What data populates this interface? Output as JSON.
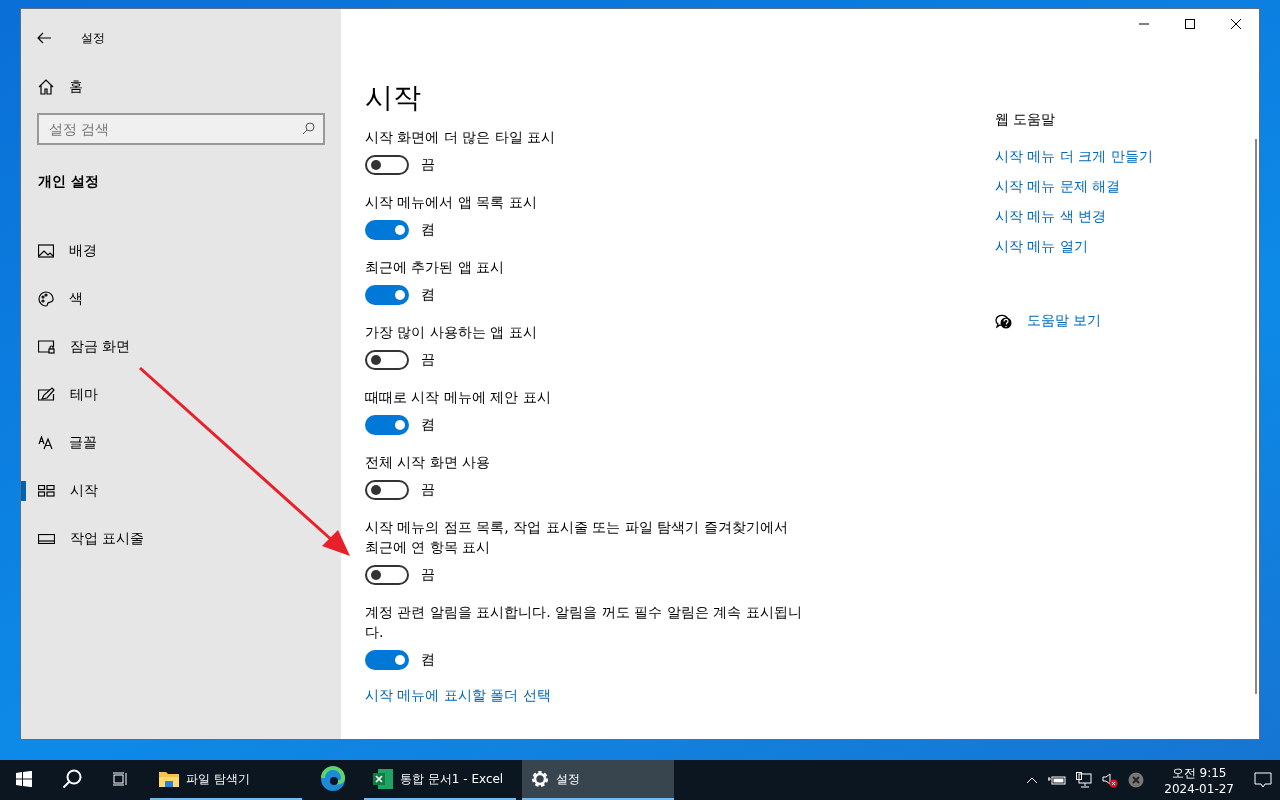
{
  "window": {
    "title": "설정"
  },
  "sidebar": {
    "home": "홈",
    "search": {
      "placeholder": "설정 검색"
    },
    "section": "개인 설정",
    "items": [
      {
        "label": "배경",
        "selected": false
      },
      {
        "label": "색",
        "selected": false
      },
      {
        "label": "잠금 화면",
        "selected": false
      },
      {
        "label": "테마",
        "selected": false
      },
      {
        "label": "글꼴",
        "selected": false
      },
      {
        "label": "시작",
        "selected": true
      },
      {
        "label": "작업 표시줄",
        "selected": false
      }
    ]
  },
  "page": {
    "title": "시작",
    "settings": [
      {
        "label": "시작 화면에 더 많은 타일 표시",
        "on": false,
        "state": "끔"
      },
      {
        "label": "시작 메뉴에서 앱 목록 표시",
        "on": true,
        "state": "켬"
      },
      {
        "label": "최근에 추가된 앱 표시",
        "on": true,
        "state": "켬"
      },
      {
        "label": "가장 많이 사용하는 앱 표시",
        "on": false,
        "state": "끔"
      },
      {
        "label": "때때로 시작 메뉴에 제안 표시",
        "on": true,
        "state": "켬"
      },
      {
        "label": "전체 시작 화면 사용",
        "on": false,
        "state": "끔"
      },
      {
        "label": "시작 메뉴의 점프 목록, 작업 표시줄 또는 파일 탐색기 즐겨찾기에서 최근에 연 항목 표시",
        "on": false,
        "state": "끔"
      },
      {
        "label": "계정 관련 알림을 표시합니다. 알림을 꺼도 필수 알림은 계속 표시됩니다.",
        "on": true,
        "state": "켬"
      }
    ],
    "link": "시작 메뉴에 표시할 폴더 선택"
  },
  "help": {
    "title": "웹 도움말",
    "links": [
      "시작 메뉴 더 크게 만들기",
      "시작 메뉴 문제 해결",
      "시작 메뉴 색 변경",
      "시작 메뉴 열기"
    ],
    "get_help": "도움말 보기"
  },
  "taskbar": {
    "apps": [
      {
        "kind": "explorer",
        "label": "파일 탐색기",
        "running": true,
        "selected": false
      },
      {
        "kind": "edge",
        "running": false,
        "selected": false
      },
      {
        "kind": "excel",
        "label": "통합 문서1 - Excel",
        "running": true,
        "selected": false
      },
      {
        "kind": "settings",
        "label": "설정",
        "running": true,
        "selected": true
      }
    ],
    "time": "오전 9:15",
    "date": "2024-01-27"
  }
}
